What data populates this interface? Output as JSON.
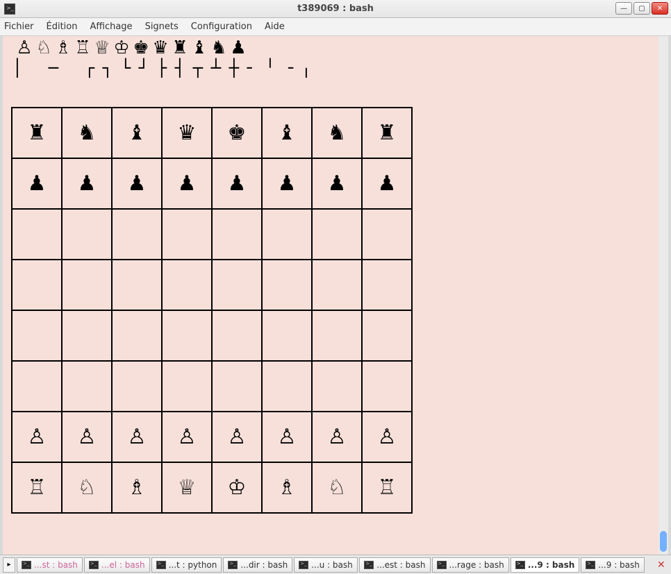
{
  "window": {
    "title": "t389069 : bash"
  },
  "menu": {
    "items": [
      "Fichier",
      "Édition",
      "Affichage",
      "Signets",
      "Configuration",
      "Aide"
    ]
  },
  "piece_palette": [
    "♙",
    "♘",
    "♗",
    "♖",
    "♕",
    "♔",
    "♚",
    "♛",
    "♜",
    "♝",
    "♞",
    "♟"
  ],
  "box_drawing": [
    "│",
    " ",
    "─",
    " ",
    "┌",
    "┐",
    "└",
    "┘",
    "├",
    "┤",
    "┬",
    "┴",
    "┼",
    "╴",
    "╵",
    "╶",
    "╷"
  ],
  "board": [
    [
      "♜",
      "♞",
      "♝",
      "♛",
      "♚",
      "♝",
      "♞",
      "♜"
    ],
    [
      "♟",
      "♟",
      "♟",
      "♟",
      "♟",
      "♟",
      "♟",
      "♟"
    ],
    [
      "",
      "",
      "",
      "",
      "",
      "",
      "",
      ""
    ],
    [
      "",
      "",
      "",
      "",
      "",
      "",
      "",
      ""
    ],
    [
      "",
      "",
      "",
      "",
      "",
      "",
      "",
      ""
    ],
    [
      "",
      "",
      "",
      "",
      "",
      "",
      "",
      ""
    ],
    [
      "♙",
      "♙",
      "♙",
      "♙",
      "♙",
      "♙",
      "♙",
      "♙"
    ],
    [
      "♖",
      "♘",
      "♗",
      "♕",
      "♔",
      "♗",
      "♘",
      "♖"
    ]
  ],
  "tabs": [
    {
      "label": "...st : bash",
      "pink": true,
      "active": false
    },
    {
      "label": "...el : bash",
      "pink": true,
      "active": false
    },
    {
      "label": "...t : python",
      "pink": false,
      "active": false
    },
    {
      "label": "...dir : bash",
      "pink": false,
      "active": false
    },
    {
      "label": "...u : bash",
      "pink": false,
      "active": false
    },
    {
      "label": "...est : bash",
      "pink": false,
      "active": false
    },
    {
      "label": "...rage : bash",
      "pink": false,
      "active": false
    },
    {
      "label": "...9 : bash",
      "pink": false,
      "active": true
    },
    {
      "label": "...9 : bash",
      "pink": false,
      "active": false
    }
  ]
}
